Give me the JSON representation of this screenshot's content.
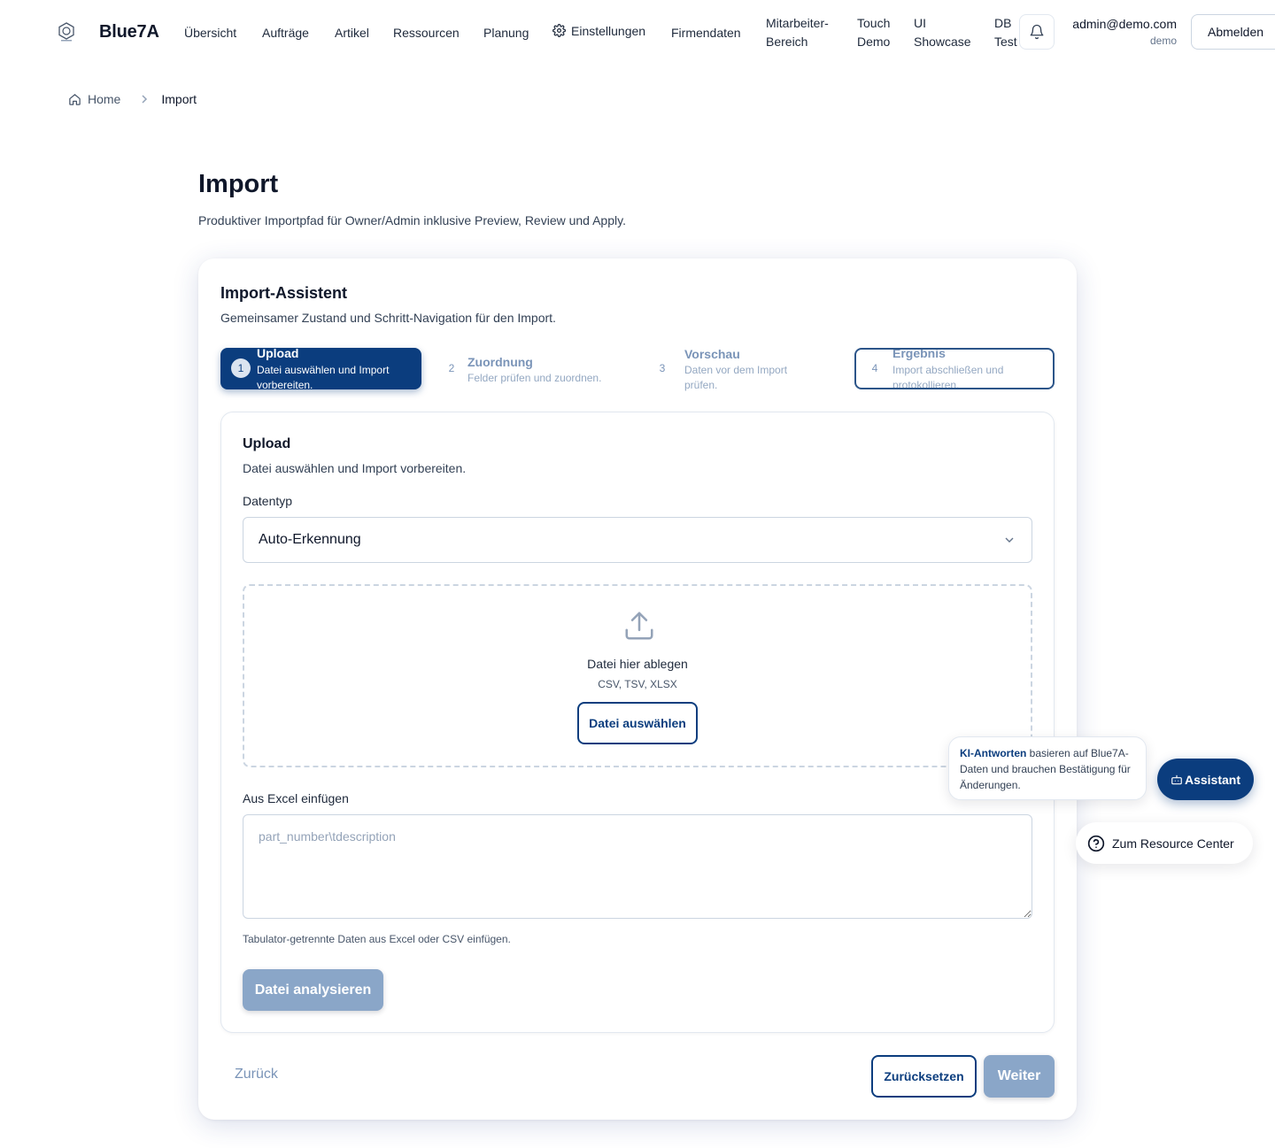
{
  "app": {
    "brand": "Blue7A",
    "logo_text": "Blue7A"
  },
  "nav": {
    "items": [
      {
        "label": "Übersicht"
      },
      {
        "label": "Aufträge"
      },
      {
        "label": "Artikel"
      },
      {
        "label": "Ressourcen"
      },
      {
        "label": "Planung"
      },
      {
        "label": "Einstellungen",
        "icon": "gear-icon"
      },
      {
        "label": "Firmendaten"
      },
      {
        "label_line1": "Mitarbeiter-",
        "label_line2": "Bereich"
      },
      {
        "label_line1": "Touch",
        "label_line2": "Demo"
      },
      {
        "label_line1": "UI",
        "label_line2": "Showcase"
      },
      {
        "label_line1": "DB",
        "label_line2": "Test"
      }
    ]
  },
  "user": {
    "email": "admin@demo.com",
    "role": "demo",
    "logout_label": "Abmelden"
  },
  "breadcrumb": {
    "home": "Home",
    "current": "Import"
  },
  "page": {
    "title": "Import",
    "subtitle": "Produktiver Importpfad für Owner/Admin inklusive Preview, Review und Apply."
  },
  "wizard": {
    "title": "Import-Assistent",
    "subtitle": "Gemeinsamer Zustand und Schritt-Navigation für den Import.",
    "steps": [
      {
        "num": "1",
        "title": "Upload",
        "desc": "Datei auswählen und Import vorbereiten.",
        "state": "active"
      },
      {
        "num": "2",
        "title": "Zuordnung",
        "desc": "Felder prüfen und zuordnen.",
        "state": "inactive"
      },
      {
        "num": "3",
        "title": "Vorschau",
        "desc": "Daten vor dem Import prüfen.",
        "state": "inactive"
      },
      {
        "num": "4",
        "title": "Ergebnis",
        "desc": "Import abschließen und protokollieren.",
        "state": "outlined"
      }
    ],
    "back_label": "Zurück",
    "reset_label": "Zurücksetzen",
    "next_label": "Weiter"
  },
  "upload": {
    "title": "Upload",
    "subtitle": "Datei auswählen und Import vorbereiten.",
    "datatype_label": "Datentyp",
    "datatype_value": "Auto-Erkennung",
    "drop_text": "Datei hier ablegen",
    "drop_types": "CSV, TSV, XLSX",
    "choose_file_label": "Datei auswählen",
    "paste_label": "Aus Excel einfügen",
    "paste_placeholder": "part_number\\tdescription",
    "paste_hint": "Tabulator-getrennte Daten aus Excel oder CSV einfügen.",
    "analyze_label": "Datei analysieren"
  },
  "assistant": {
    "bubble_bold": "KI-Antworten",
    "bubble_text": " basieren auf Blue7A-Daten und brauchen Bestätigung für Änderungen.",
    "button_label": "Assistant",
    "resource_label": "Zum Resource Center"
  },
  "colors": {
    "primary": "#0b3d7e",
    "disabled": "#8aa6c8",
    "muted_step": "#7a94b8"
  }
}
